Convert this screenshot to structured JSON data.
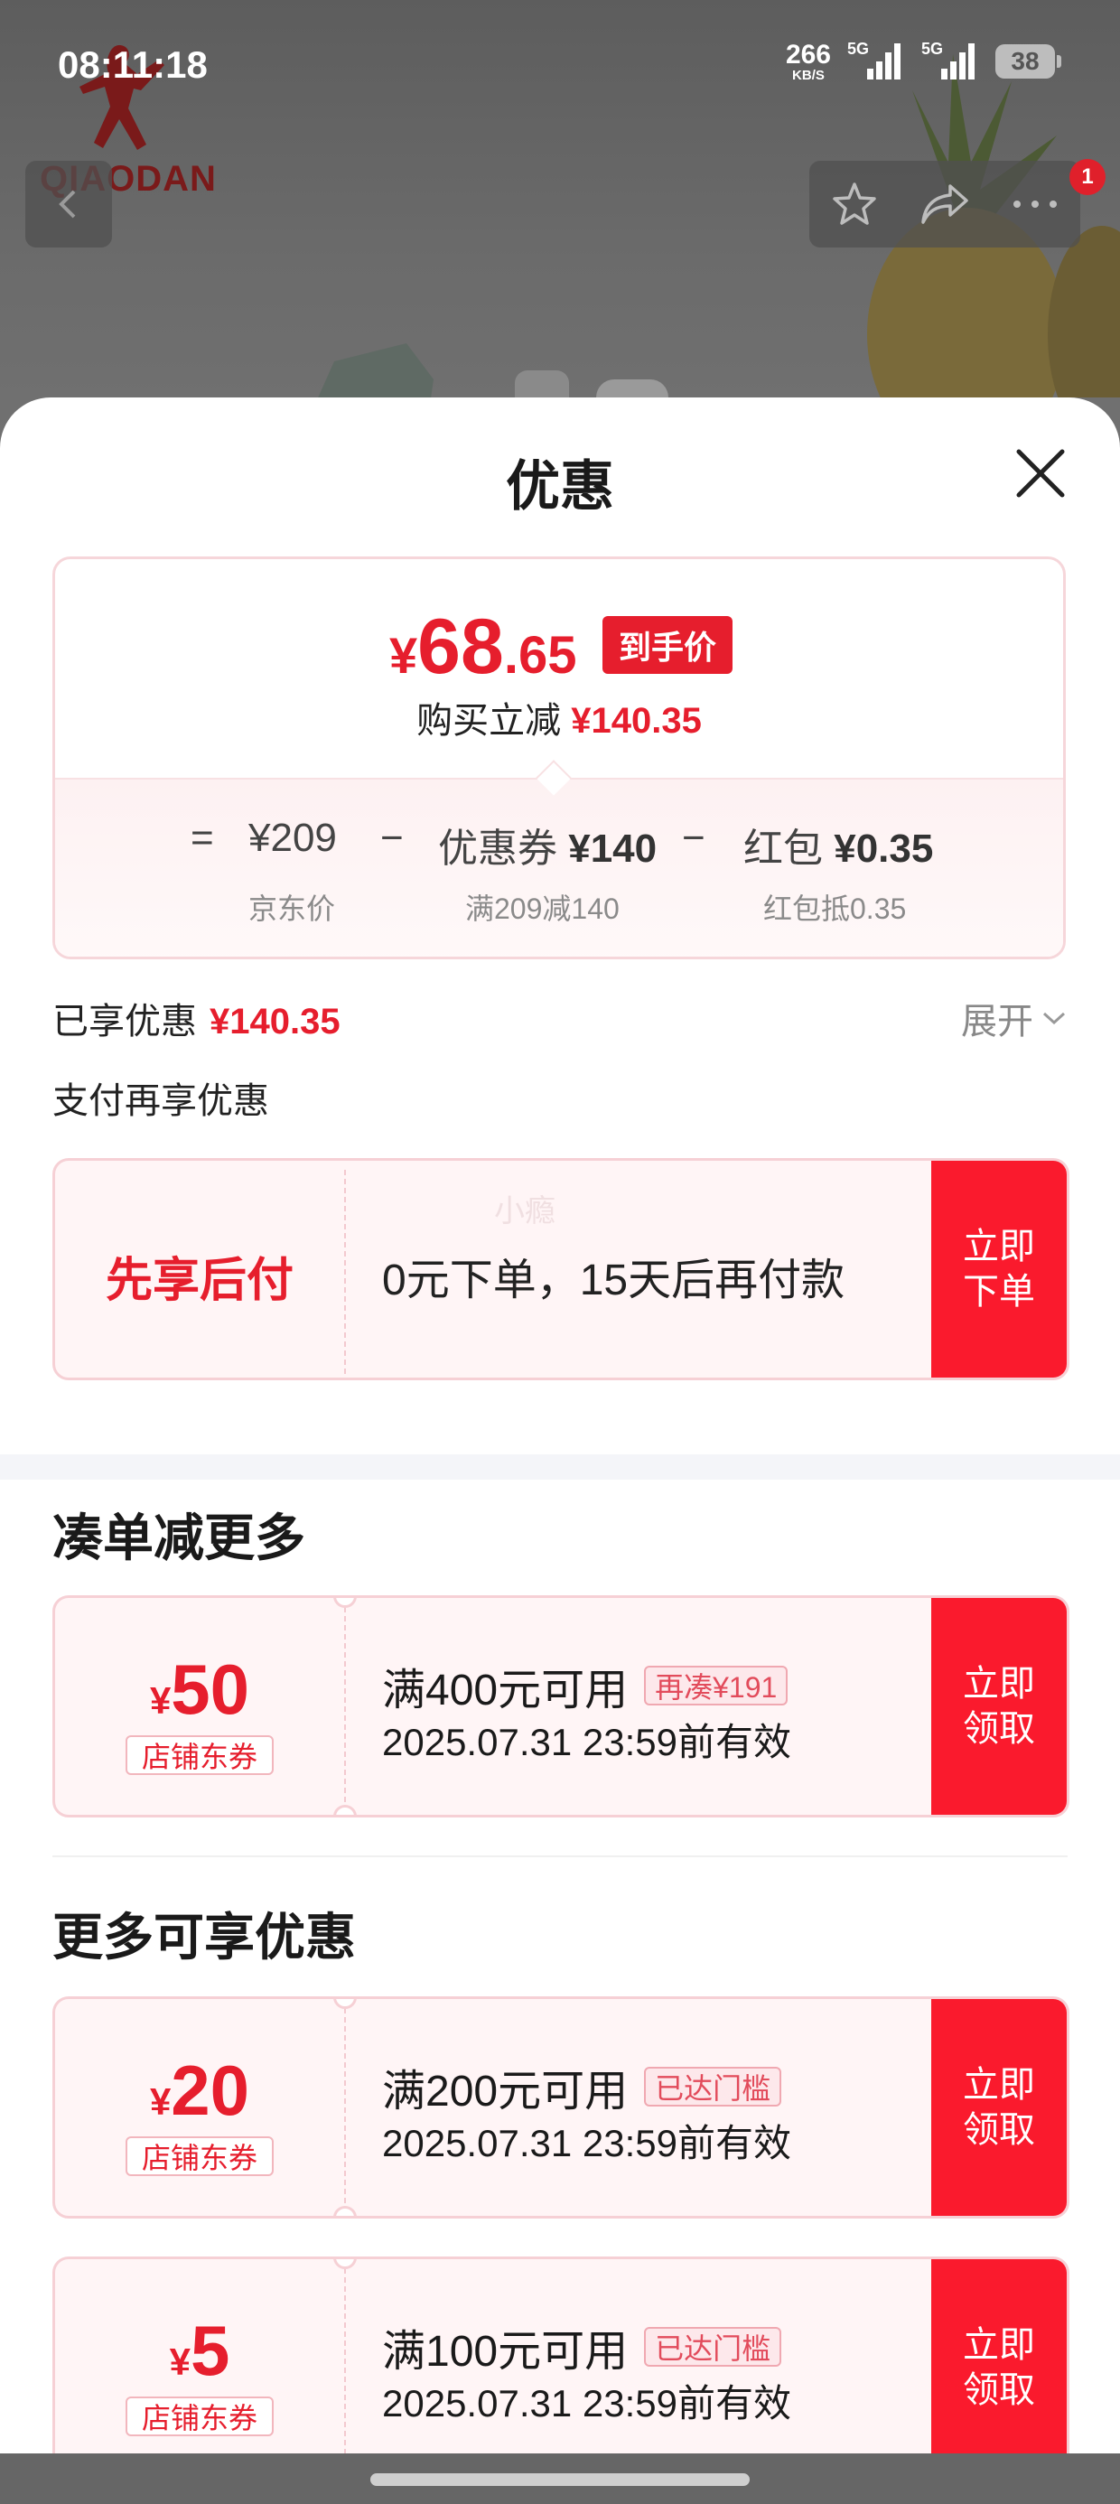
{
  "status_bar": {
    "time": "08:11:18",
    "net_speed": "266",
    "net_unit": "KB/S",
    "sig1": "5G",
    "sig2": "5G",
    "battery": "38"
  },
  "background": {
    "brand": "QIAODAN",
    "notification_count": "1"
  },
  "sheet": {
    "title": "优惠",
    "price_summary": {
      "currency": "¥",
      "final_int": "68",
      "final_dec": ".65",
      "final_tag": "到手价",
      "reduce_label": "购买立减",
      "reduce_amount": "¥140.35",
      "eq": "=",
      "minus": "−",
      "jd_price": "¥209",
      "jd_label": "京东价",
      "coupon_prefix": "优惠券",
      "coupon_amount": "¥140",
      "coupon_sub": "满209减140",
      "redpack_prefix": "红包",
      "redpack_amount": "¥0.35",
      "redpack_sub": "红包抵0.35"
    },
    "enjoyed_label": "已享优惠",
    "enjoyed_amount": "¥140.35",
    "expand_label": "展开",
    "pay_more_label": "支付再享优惠",
    "bnpl": {
      "title": "先享后付",
      "desc": "0元下单，15天后再付款",
      "watermark": "小瘾",
      "cta": "立即下单"
    },
    "section_combine": "凑单减更多",
    "section_more": "更多可享优惠",
    "coupons": [
      {
        "currency": "¥",
        "amount": "50",
        "type": "店铺东券",
        "condition": "满400元可用",
        "tag": "再凑¥191",
        "valid": "2025.07.31 23:59前有效",
        "cta": "立即领取"
      },
      {
        "currency": "¥",
        "amount": "20",
        "type": "店铺东券",
        "condition": "满200元可用",
        "tag": "已达门槛",
        "valid": "2025.07.31 23:59前有效",
        "cta": "立即领取"
      },
      {
        "currency": "¥",
        "amount": "5",
        "type": "店铺东券",
        "condition": "满100元可用",
        "tag": "已达门槛",
        "valid": "2025.07.31 23:59前有效",
        "cta": "立即领取"
      }
    ]
  },
  "colors": {
    "accent": "#e61e2d",
    "cta": "#fa1a2d",
    "ticket_bg": "#fff5f6"
  },
  "icons": [
    "back-arrow-icon",
    "star-icon",
    "share-icon",
    "more-icon",
    "close-icon",
    "chevron-down-icon"
  ]
}
